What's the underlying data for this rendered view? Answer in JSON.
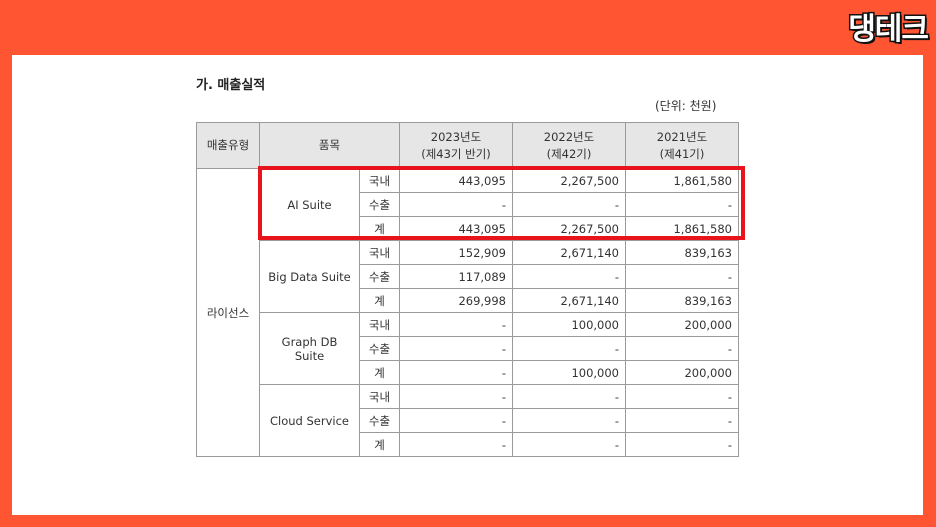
{
  "logo": "댕테크",
  "document": {
    "section_title": "가. 매출실적",
    "unit": "(단위: 천원)"
  },
  "table": {
    "headers": {
      "sales_type": "매출유형",
      "item": "품목",
      "y2023": [
        "2023년도",
        "(제43기 반기)"
      ],
      "y2022": [
        "2022년도",
        "(제42기)"
      ],
      "y2021": [
        "2021년도",
        "(제41기)"
      ]
    },
    "sales_type_value": "라이선스",
    "groups": [
      {
        "name": "AI Suite",
        "rows": [
          {
            "sub": "국내",
            "v2023": "443,095",
            "v2022": "2,267,500",
            "v2021": "1,861,580"
          },
          {
            "sub": "수출",
            "v2023": "-",
            "v2022": "-",
            "v2021": "-"
          },
          {
            "sub": "계",
            "v2023": "443,095",
            "v2022": "2,267,500",
            "v2021": "1,861,580"
          }
        ]
      },
      {
        "name": "Big Data Suite",
        "rows": [
          {
            "sub": "국내",
            "v2023": "152,909",
            "v2022": "2,671,140",
            "v2021": "839,163"
          },
          {
            "sub": "수출",
            "v2023": "117,089",
            "v2022": "-",
            "v2021": "-"
          },
          {
            "sub": "계",
            "v2023": "269,998",
            "v2022": "2,671,140",
            "v2021": "839,163"
          }
        ]
      },
      {
        "name": "Graph DB Suite",
        "rows": [
          {
            "sub": "국내",
            "v2023": "-",
            "v2022": "100,000",
            "v2021": "200,000"
          },
          {
            "sub": "수출",
            "v2023": "-",
            "v2022": "-",
            "v2021": "-"
          },
          {
            "sub": "계",
            "v2023": "-",
            "v2022": "100,000",
            "v2021": "200,000"
          }
        ]
      },
      {
        "name": "Cloud Service",
        "rows": [
          {
            "sub": "국내",
            "v2023": "-",
            "v2022": "-",
            "v2021": "-"
          },
          {
            "sub": "수출",
            "v2023": "-",
            "v2022": "-",
            "v2021": "-"
          },
          {
            "sub": "계",
            "v2023": "-",
            "v2022": "-",
            "v2021": "-"
          }
        ]
      }
    ]
  },
  "colors": {
    "background": "#ff5533",
    "highlight_border": "#e8141c",
    "header_fill": "#e6e6e6"
  }
}
